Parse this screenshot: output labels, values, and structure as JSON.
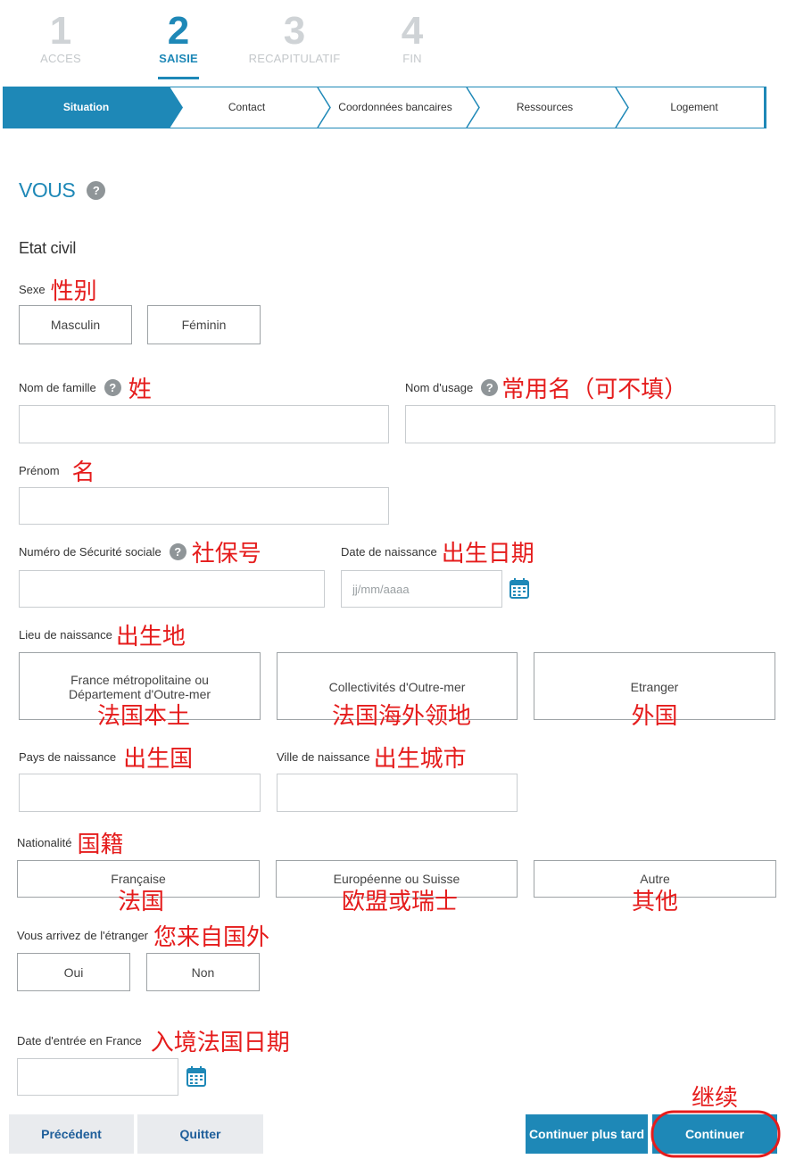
{
  "steps": [
    {
      "num": "1",
      "label": "ACCES"
    },
    {
      "num": "2",
      "label": "SAISIE"
    },
    {
      "num": "3",
      "label": "RECAPITULATIF"
    },
    {
      "num": "4",
      "label": "FIN"
    }
  ],
  "tabs": [
    "Situation",
    "Contact",
    "Coordonnées bancaires",
    "Ressources",
    "Logement"
  ],
  "heading": "VOUS",
  "section": "Etat civil",
  "help_glyph": "?",
  "fields": {
    "sexe": {
      "label": "Sexe",
      "note": "性别",
      "options": [
        "Masculin",
        "Féminin"
      ]
    },
    "nom_famille": {
      "label": "Nom de famille",
      "note": "姓",
      "value": ""
    },
    "nom_usage": {
      "label": "Nom d'usage",
      "note": "常用名（可不填）",
      "value": ""
    },
    "prenom": {
      "label": "Prénom",
      "note": "名",
      "value": ""
    },
    "secu": {
      "label": "Numéro de Sécurité sociale",
      "note": "社保号",
      "value": ""
    },
    "date_naissance": {
      "label": "Date de naissance",
      "note": "出生日期",
      "placeholder": "jj/mm/aaaa"
    },
    "lieu": {
      "label": "Lieu de naissance",
      "note": "出生地",
      "options": [
        {
          "label": "France métropolitaine ou Département d'Outre-mer",
          "note": "法国本土"
        },
        {
          "label": "Collectivités d'Outre-mer",
          "note": "法国海外领地"
        },
        {
          "label": "Etranger",
          "note": "外国"
        }
      ]
    },
    "pays": {
      "label": "Pays de naissance",
      "note": "出生国",
      "value": ""
    },
    "ville": {
      "label": "Ville de naissance",
      "note": "出生城市",
      "value": ""
    },
    "nationalite": {
      "label": "Nationalité",
      "note": "国籍",
      "options": [
        {
          "label": "Française",
          "note": "法国"
        },
        {
          "label": "Européenne ou Suisse",
          "note": "欧盟或瑞士"
        },
        {
          "label": "Autre",
          "note": "其他"
        }
      ]
    },
    "etranger": {
      "label": "Vous arrivez de l'étranger",
      "note": "您来自国外",
      "options": [
        "Oui",
        "Non"
      ]
    },
    "date_entree": {
      "label": "Date d'entrée en France",
      "note": "入境法国日期",
      "placeholder": ""
    }
  },
  "footer": {
    "precedent": "Précédent",
    "quitter": "Quitter",
    "plus_tard": "Continuer plus tard",
    "continuer": "Continuer",
    "continuer_note": "继续"
  },
  "colors": {
    "accent": "#1e88b7",
    "annotation": "#e51c1c",
    "inactive_step": "#cfd3d6"
  }
}
